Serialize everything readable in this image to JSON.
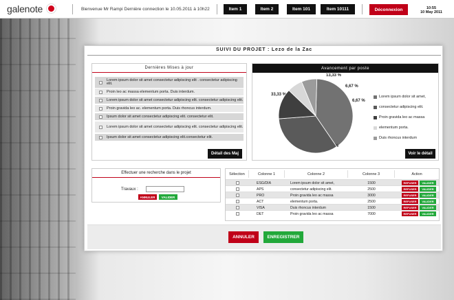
{
  "header": {
    "logo": "galenote",
    "welcome": "Bienvenue Mr Rampi  Dernière connection le 10.05.2011 à 10h22",
    "nav": [
      "Item 1",
      "Item 2",
      "Item 101",
      "Item 10111"
    ],
    "logout": "Déconnexion",
    "time": "10:55",
    "date": "10 May 2011"
  },
  "project": {
    "title": "SUIVI DU PROJET :  Lezo de la Zac"
  },
  "updates": {
    "title": "Dernières Mises à jour",
    "items": [
      "Lorem ipsum dolor sit amet consectetur adipiscing elit . consectetur adipiscing elit.",
      "Proin  leo ac massa elementum porta. Duis interdum.",
      "Lorem ipsum dolor sit amet consectetur adipiscing elit. consectetur  adipiscing elit.",
      "Proin gravida leo ac. elementum porta. Duis rhoncus interdum.",
      "Ipsum dolor sit amet consectetur adipiscing elit. consectetur elit.",
      "Lorem ipsum dolor sit amet consectetur adipiscing elit. consectetur adipiscing elit.",
      "Ipsum dolor sit amet consectetur adipiscing elit.consectetur elit."
    ],
    "button": "Détail des Maj"
  },
  "progress": {
    "title": "Avancement par poste",
    "button": "Voir le détail"
  },
  "chart_data": {
    "type": "pie",
    "title": "Avancement par poste",
    "series": [
      {
        "name": "Lorem ipsum dolor sit amet,",
        "value": 40,
        "label": "40,00 %",
        "color": "#727272"
      },
      {
        "name": "consectetur adipiscing elit.",
        "value": 33.33,
        "label": "33,33 %",
        "color": "#5a5a5a"
      },
      {
        "name": "Proin gravida leo ac massa",
        "value": 13.33,
        "label": "13,33 %",
        "color": "#3f3f3f"
      },
      {
        "name": "elementum porta.",
        "value": 6.67,
        "label": "6,67 %",
        "color": "#d8d8d8"
      },
      {
        "name": "Duis rhoncus interdum",
        "value": 6.67,
        "label": "6,67 %",
        "color": "#9b9b9b"
      }
    ]
  },
  "search": {
    "title": "Effectuer une recherche dans le projet",
    "label": "Travaux :",
    "value": "",
    "reject": "ANNULER",
    "validate": "VALIDER"
  },
  "table": {
    "headers": [
      "Sélection",
      "Colonne 1",
      "Colonne 2",
      "Colonne 3",
      "Action"
    ],
    "rows": [
      {
        "c1": "ESG/DIA",
        "c2": "Lorem ipsum dolor sit amet,",
        "c3": "1500"
      },
      {
        "c1": "APS",
        "c2": "consectetur adipiscing elit.",
        "c3": "2500"
      },
      {
        "c1": "PRO",
        "c2": "Proin gravida leo ac massa",
        "c3": "3000"
      },
      {
        "c1": "ACT",
        "c2": "elementum porta.",
        "c3": "2500"
      },
      {
        "c1": "VISA",
        "c2": "Duis rhoncus interdum",
        "c3": "1500"
      },
      {
        "c1": "DET",
        "c2": "Proin gravida leo ac massa",
        "c3": "7000"
      }
    ],
    "refuse": "REFUSER",
    "validate": "VALIDER"
  },
  "footer": {
    "cancel": "ANNULER",
    "save": "ENREGISTRER"
  }
}
